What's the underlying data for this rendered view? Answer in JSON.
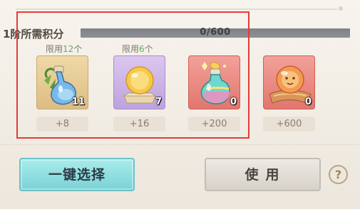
{
  "progress": {
    "label": "1阶所需积分",
    "current": 0,
    "max": 600,
    "text": "0/600",
    "fraction": 0.0
  },
  "items": [
    {
      "icon": "blue-potion-bottle-icon",
      "limit_prefix": "限用",
      "limit_num": "12",
      "limit_suffix": "个",
      "count": "11",
      "points": "+8"
    },
    {
      "icon": "golden-orb-on-stand-icon",
      "limit_prefix": "限用",
      "limit_num": "6",
      "limit_suffix": "个",
      "count": "7",
      "points": "+16"
    },
    {
      "icon": "rainbow-potion-flask-icon",
      "count": "0",
      "points": "+200"
    },
    {
      "icon": "fire-orb-on-cloth-icon",
      "count": "0",
      "points": "+600"
    }
  ],
  "buttons": {
    "quick_select": "一键选择",
    "use": "使用",
    "help": "?"
  },
  "colors": {
    "highlight": "#e53a3a",
    "accent_teal": "#7bd2d5",
    "limit_number": "#67a86a"
  }
}
